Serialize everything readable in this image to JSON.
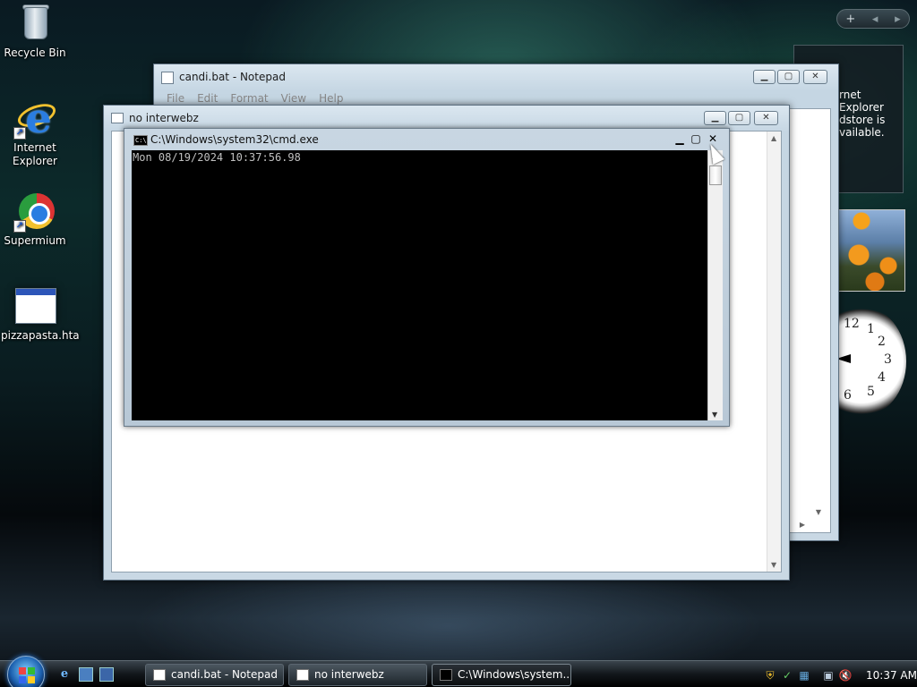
{
  "desktop": {
    "icons": [
      {
        "label": "Recycle Bin"
      },
      {
        "label": "Internet Explorer"
      },
      {
        "label": "Supermium"
      },
      {
        "label": "pizzapasta.hta"
      }
    ]
  },
  "sidebar": {
    "controls": "+ ◂ ▸",
    "feed_text_line1": "rnet Explorer",
    "feed_text_line2": "dstore is",
    "feed_text_line3": "vailable."
  },
  "notepad": {
    "title": "candi.bat - Notepad",
    "menu": [
      "File",
      "Edit",
      "Format",
      "View",
      "Help"
    ]
  },
  "nointerwebz": {
    "title": "no interwebz"
  },
  "cmd": {
    "title": "C:\\Windows\\system32\\cmd.exe",
    "icon_text": "C:\\",
    "output": "Mon 08/19/2024 10:37:56.98"
  },
  "taskbar": {
    "buttons": [
      {
        "label": "candi.bat - Notepad"
      },
      {
        "label": "no interwebz"
      },
      {
        "label": "C:\\Windows\\system..."
      }
    ],
    "clock": "10:37 AM"
  },
  "clock_gadget": {
    "numbers": [
      "12",
      "1",
      "2",
      "3",
      "4",
      "5",
      "6"
    ]
  }
}
